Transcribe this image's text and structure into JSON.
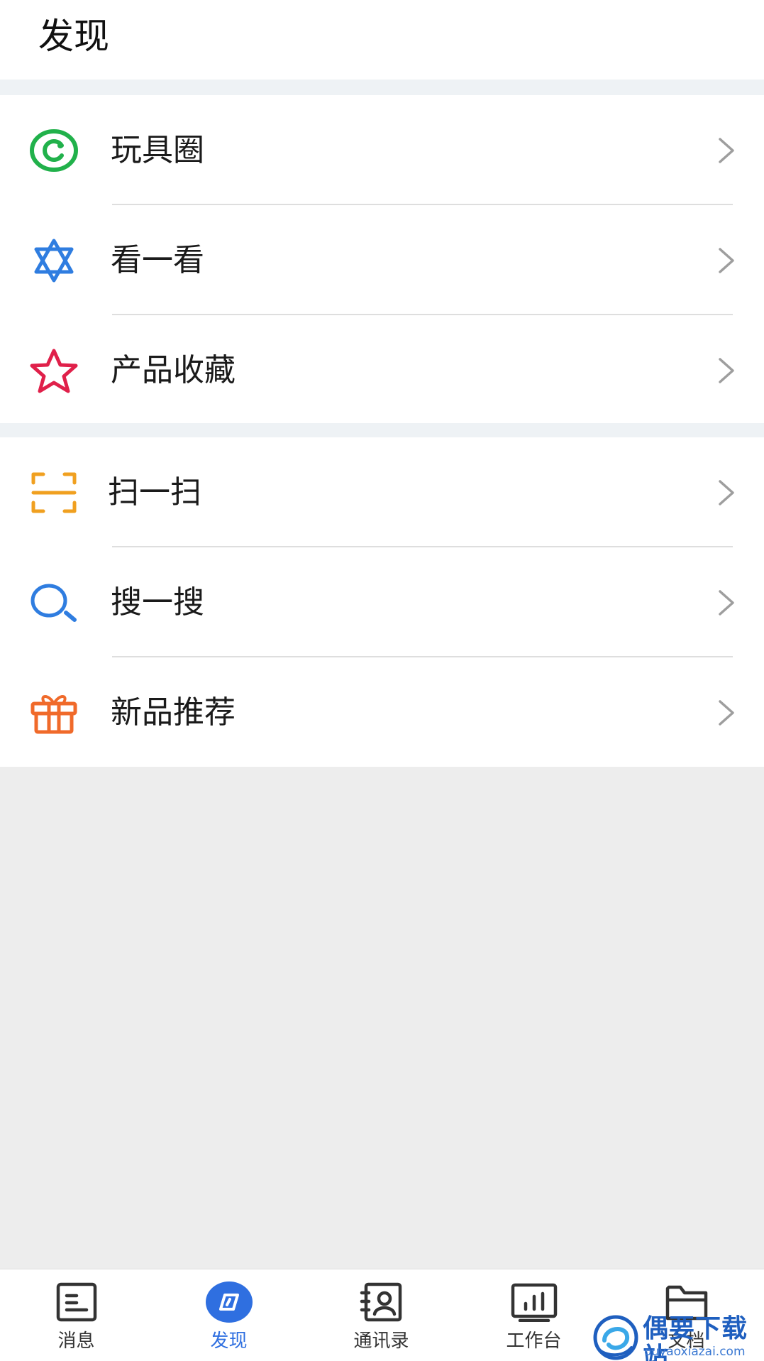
{
  "header": {
    "title": "发现"
  },
  "sections": [
    {
      "items": [
        {
          "label": "玩具圈",
          "icon": "toy-circle-icon",
          "color": "#21b14b"
        },
        {
          "label": "看一看",
          "icon": "star-of-david-icon",
          "color": "#2f7de0"
        },
        {
          "label": "产品收藏",
          "icon": "star-outline-icon",
          "color": "#e0204a"
        }
      ]
    },
    {
      "items": [
        {
          "label": "扫一扫",
          "icon": "scan-icon",
          "color": "#f0a020"
        },
        {
          "label": "搜一搜",
          "icon": "search-icon",
          "color": "#2f7de0"
        },
        {
          "label": "新品推荐",
          "icon": "gift-icon",
          "color": "#f06a2a"
        }
      ]
    }
  ],
  "tabbar": {
    "tabs": [
      {
        "label": "消息",
        "icon": "message-icon"
      },
      {
        "label": "发现",
        "icon": "compass-icon",
        "active": true
      },
      {
        "label": "通讯录",
        "icon": "contacts-icon"
      },
      {
        "label": "工作台",
        "icon": "workbench-icon"
      },
      {
        "label": "文档",
        "icon": "folder-icon"
      }
    ],
    "active_color": "#2f6fe0"
  },
  "watermark": {
    "text": "偶要下载站",
    "sub": "ouyaoxiazai.com"
  }
}
